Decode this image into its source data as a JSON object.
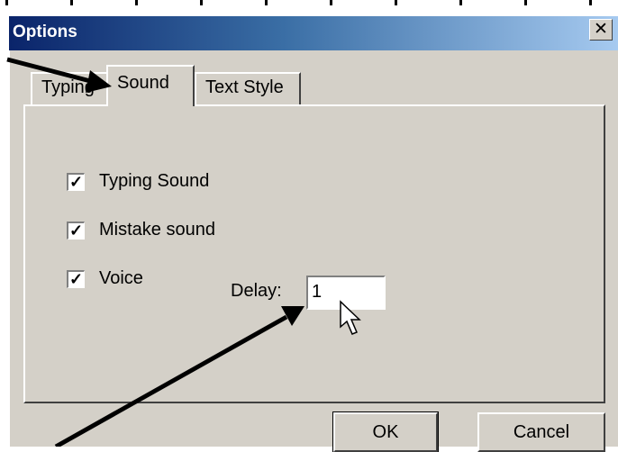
{
  "window": {
    "title": "Options",
    "close_glyph": "✕"
  },
  "tabs": [
    {
      "label": "Typing"
    },
    {
      "label": "Sound",
      "selected": true
    },
    {
      "label": "Text Style"
    }
  ],
  "checkboxes": [
    {
      "label": "Typing Sound",
      "checked": true,
      "mark": "✓"
    },
    {
      "label": "Mistake sound",
      "checked": true,
      "mark": "✓"
    },
    {
      "label": "Voice",
      "checked": true,
      "mark": "✓"
    }
  ],
  "delay": {
    "label": "Delay:",
    "value": "1"
  },
  "buttons": {
    "ok": "OK",
    "cancel": "Cancel"
  },
  "annotations": {
    "arrow_color": "#000000",
    "cursor_icon": "mouse-pointer-icon"
  },
  "colors": {
    "title_start": "#0a246a",
    "title_end": "#a6caf0",
    "dialog_bg": "#d4d0c8"
  }
}
